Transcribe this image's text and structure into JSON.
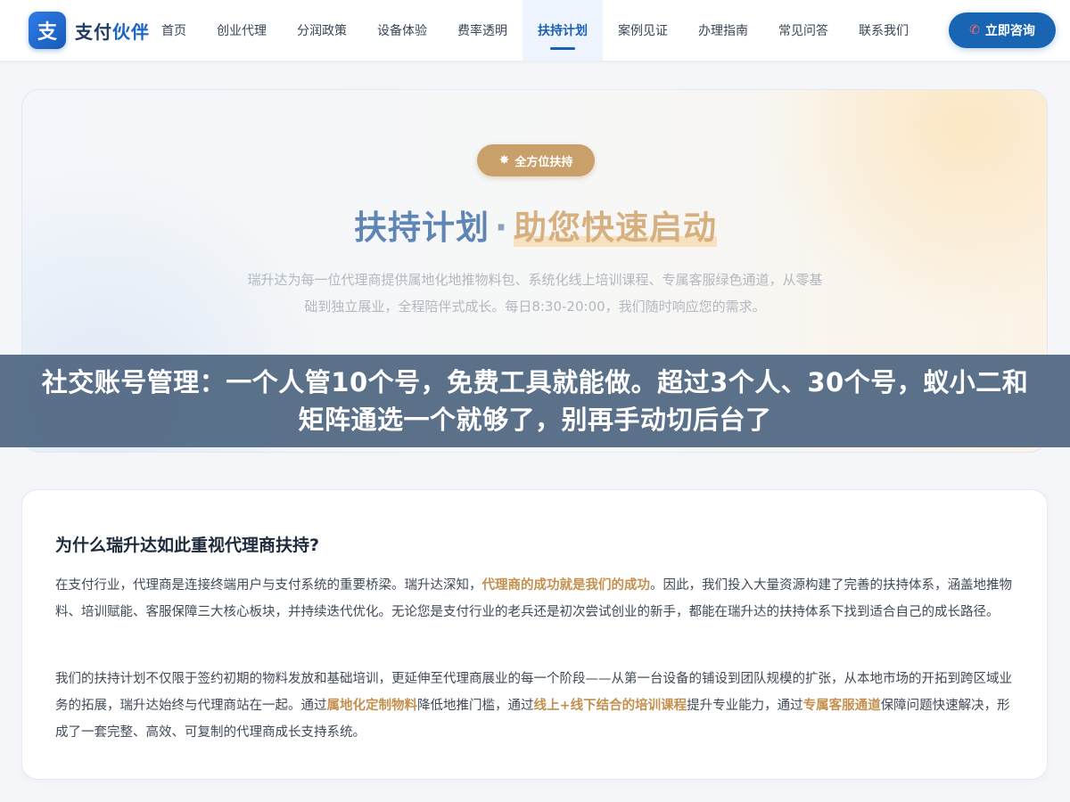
{
  "header": {
    "logo_mark": "支",
    "logo_text_main": "支付",
    "logo_text_accent": "伙伴",
    "nav": [
      {
        "label": "首页"
      },
      {
        "label": "创业代理"
      },
      {
        "label": "分润政策"
      },
      {
        "label": "设备体验"
      },
      {
        "label": "费率透明"
      },
      {
        "label": "扶持计划"
      },
      {
        "label": "案例见证"
      },
      {
        "label": "办理指南"
      },
      {
        "label": "常见问答"
      },
      {
        "label": "联系我们"
      }
    ],
    "active_nav": "扶持计划",
    "cta_icon": "phone-icon",
    "cta_label": "立即咨询"
  },
  "hero": {
    "badge_icon": "sparkle-icon",
    "badge_label": "全方位扶持",
    "title_main": "扶持计划",
    "title_sep": "·",
    "title_accent": "助您快速启动",
    "description": "瑞升达为每一位代理商提供属地化地推物料包、系统化线上培训课程、专属客服绿色通道，从零基础到独立展业，全程陪伴式成长。每日8:30-20:00，我们随时响应您的需求。"
  },
  "overlay": {
    "text": "社交账号管理：一个人管10个号，免费工具就能做。超过3个人、30个号，蚁小二和矩阵通选一个就够了，别再手动切后台了"
  },
  "article": {
    "title": "为什么瑞升达如此重视代理商扶持?",
    "p1_a": "在支付行业，代理商是连接终端用户与支付系统的重要桥梁。瑞升达深知，",
    "p1_hl": "代理商的成功就是我们的成功",
    "p1_b": "。因此，我们投入大量资源构建了完善的扶持体系，涵盖地推物料、培训赋能、客服保障三大核心板块，并持续迭代优化。无论您是支付行业的老兵还是初次尝试创业的新手，都能在瑞升达的扶持体系下找到适合自己的成长路径。",
    "p2_a": "我们的扶持计划不仅限于签约初期的物料发放和基础培训，更延伸至代理商展业的每一个阶段——从第一台设备的铺设到团队规模的扩张，从本地市场的开拓到跨区域业务的拓展，瑞升达始终与代理商站在一起。通过",
    "p2_hl1": "属地化定制物料",
    "p2_b": "降低地推门槛，通过",
    "p2_hl2": "线上+线下结合的培训课程",
    "p2_c": "提升专业能力，通过",
    "p2_hl3": "专属客服通道",
    "p2_d": "保障问题快速解决，形成了一套完整、高效、可复制的代理商成长支持系统。"
  },
  "colors": {
    "brand_blue": "#1a64b4",
    "gold": "#c9a06a",
    "overlay_bg": "#526984"
  }
}
